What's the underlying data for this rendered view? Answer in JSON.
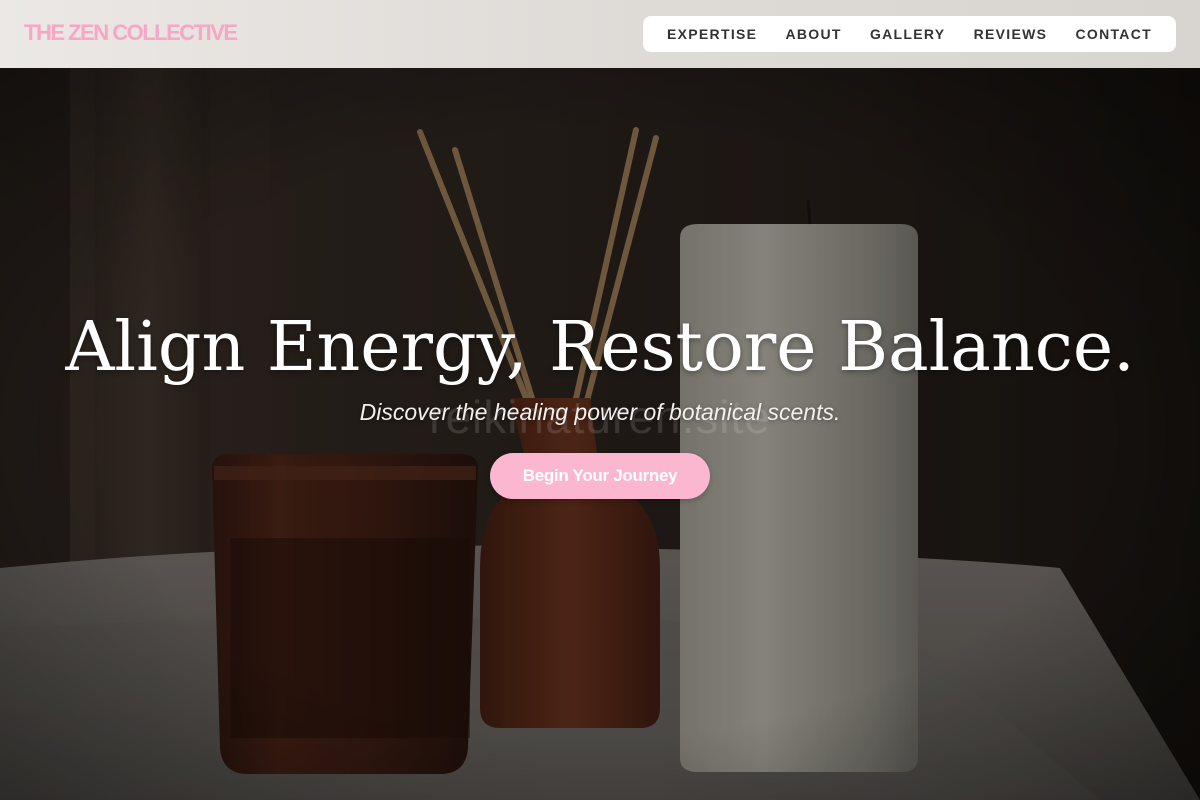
{
  "brand": {
    "logo_text": "THE ZEN COLLECTIVE",
    "accent_color": "#f7a6c6"
  },
  "nav": {
    "items": [
      {
        "label": "EXPERTISE"
      },
      {
        "label": "ABOUT"
      },
      {
        "label": "GALLERY"
      },
      {
        "label": "REVIEWS"
      },
      {
        "label": "CONTACT"
      }
    ]
  },
  "hero": {
    "title": "Align Energy, Restore Balance.",
    "subtitle": "Discover the healing power of botanical scents.",
    "watermark": "reikinaturen.site",
    "cta_label": "Begin Your Journey",
    "cta_color": "#fbb6d0"
  }
}
